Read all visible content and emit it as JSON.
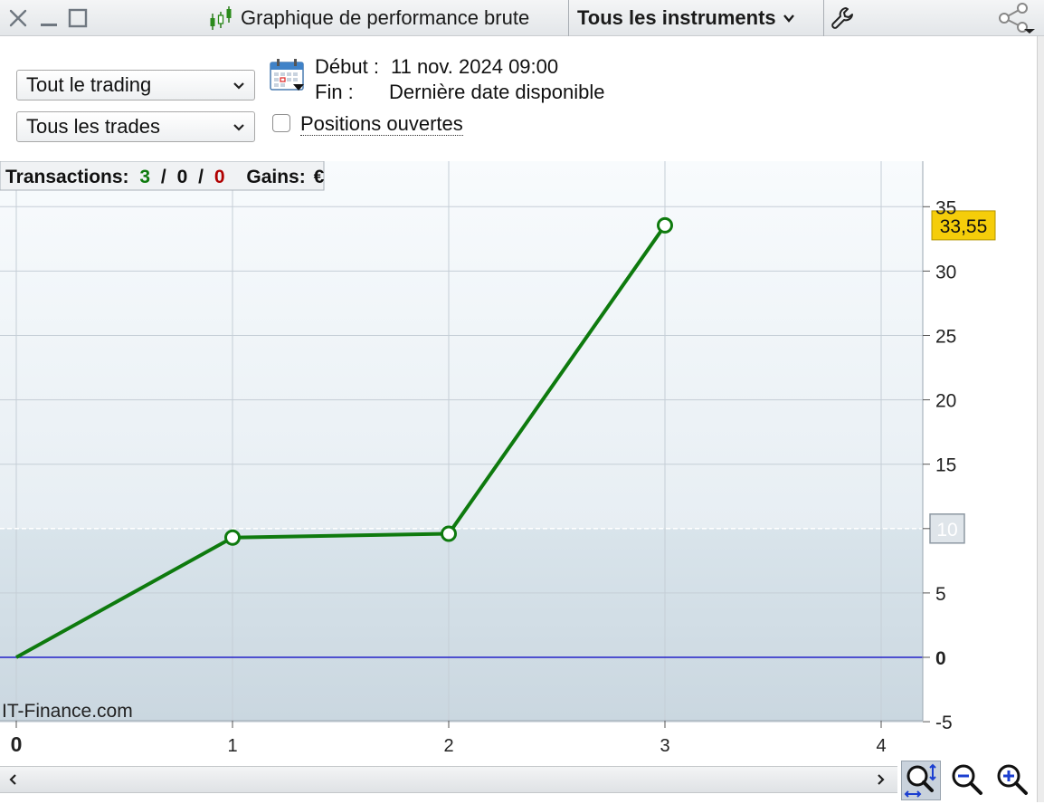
{
  "titlebar": {
    "title": "Graphique de performance brute",
    "instruments": "Tous les instruments",
    "icons": [
      "close-icon",
      "minimize-icon",
      "maximize-icon",
      "candlestick-icon",
      "wrench-icon",
      "share-icon"
    ]
  },
  "filters": {
    "trading_select": "Tout le trading",
    "trades_select": "Tous les trades",
    "start_label": "Début :",
    "start_value": "11 nov. 2024 09:00",
    "end_label": "Fin :",
    "end_value": "Dernière date disponible",
    "open_positions_label": "Positions ouvertes",
    "open_positions_checked": false
  },
  "stats": {
    "transactions_label": "Transactions:",
    "wins": "3",
    "sep1": "/",
    "neutral": "0",
    "sep2": "/",
    "losses": "0",
    "gains_label": "Gains:",
    "gains_unit": "€"
  },
  "colors": {
    "series": "#0e7a0e",
    "zero_line": "#2323c8",
    "value_badge": "#f5cd0a",
    "wins": "#0e7a0e",
    "losses": "#b00000"
  },
  "watermark": "IT-Finance.com",
  "chart_data": {
    "type": "line",
    "x": [
      0,
      1,
      2,
      3
    ],
    "values": [
      0,
      9.3,
      9.6,
      33.55
    ],
    "xlim": [
      0,
      4.2
    ],
    "ylim": [
      -5,
      35
    ],
    "x_ticks": [
      "0",
      "1",
      "2",
      "3",
      "4"
    ],
    "y_ticks": [
      "-5",
      "0",
      "5",
      "10",
      "15",
      "20",
      "25",
      "30",
      "35"
    ],
    "last_value_label": "33,55",
    "reference_line": 10,
    "reference_label": "10",
    "zero_line": 0,
    "grid": true
  }
}
